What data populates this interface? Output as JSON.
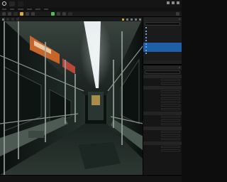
{
  "title_bar": {
    "tab_label": "",
    "second_tab": ""
  },
  "menu": [],
  "toolbar": {
    "mode_label": "",
    "play_label": "",
    "platforms_label": ""
  },
  "viewport": {
    "view_label": "",
    "lit_label": "",
    "show_label": ""
  },
  "outliner": {
    "title": "",
    "search_placeholder": "",
    "rows": [
      {
        "label": "",
        "selected": false
      },
      {
        "label": "",
        "selected": false
      },
      {
        "label": "",
        "selected": false
      },
      {
        "label": "",
        "selected": false
      },
      {
        "label": "",
        "selected": false
      },
      {
        "label": "",
        "selected": true
      },
      {
        "label": "",
        "selected": true
      },
      {
        "label": "",
        "selected": true
      },
      {
        "label": "",
        "selected": false
      }
    ],
    "footer": ""
  },
  "details": {
    "title": "",
    "search_placeholder": "",
    "sections": [
      {
        "title": "",
        "props": [
          {
            "label": "",
            "value": ""
          },
          {
            "label": "",
            "value": ""
          }
        ]
      },
      {
        "title": "",
        "props": [
          {
            "label": "",
            "value": ""
          },
          {
            "label": "",
            "value": ""
          },
          {
            "label": "",
            "value": ""
          },
          {
            "label": "",
            "value": ""
          },
          {
            "label": "",
            "value": ""
          },
          {
            "label": "",
            "value": ""
          }
        ]
      },
      {
        "title": "",
        "props": [
          {
            "label": "",
            "value": ""
          },
          {
            "label": "",
            "value": ""
          },
          {
            "label": "",
            "value": ""
          }
        ]
      },
      {
        "title": "",
        "props": [
          {
            "label": "",
            "value": ""
          },
          {
            "label": "",
            "value": ""
          },
          {
            "label": "",
            "value": ""
          }
        ]
      },
      {
        "title": "",
        "props": [
          {
            "label": "",
            "value": ""
          },
          {
            "label": "",
            "value": ""
          }
        ]
      }
    ]
  },
  "status": {
    "left": "",
    "right": ""
  },
  "colors": {
    "selection": "#1f5fa8",
    "accent": "#e0a93a",
    "play": "#4bbf5a",
    "ad_orange": "#c8652b"
  },
  "icons": [
    "unreal-logo-icon",
    "save-icon",
    "select-mode-icon",
    "play-icon",
    "settings-icon",
    "search-icon",
    "close-icon",
    "eye-icon"
  ]
}
